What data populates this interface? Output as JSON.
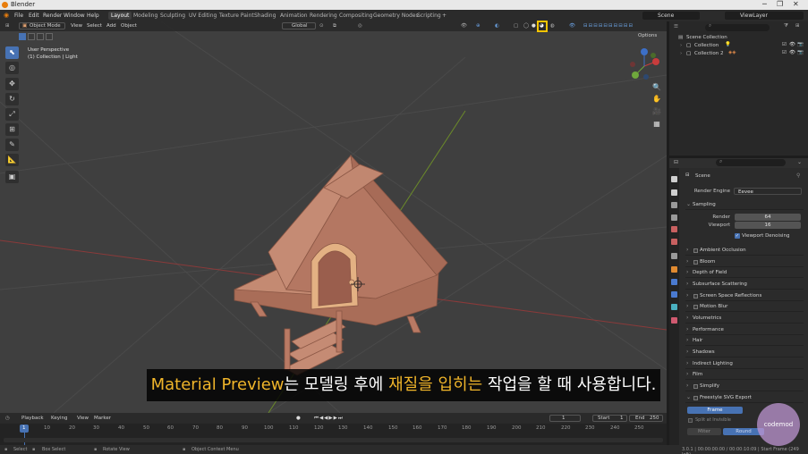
{
  "titlebar": {
    "title": "Blender"
  },
  "menu": [
    "File",
    "Edit",
    "Render",
    "Window",
    "Help"
  ],
  "workspaces": [
    "Layout",
    "Modeling",
    "Sculpting",
    "UV Editing",
    "Texture Paint",
    "Shading",
    "Animation",
    "Rendering",
    "Compositing",
    "Geometry Nodes",
    "Scripting",
    "+"
  ],
  "scene_selector": "Scene",
  "viewlayer_selector": "ViewLayer",
  "viewport": {
    "mode": "Object Mode",
    "menus": [
      "View",
      "Select",
      "Add",
      "Object"
    ],
    "orientation": "Global",
    "options_label": "Options",
    "info_line1": "User Perspective",
    "info_line2": "(1) Collection | Light"
  },
  "subtitle": {
    "part1": "Material Preview",
    "part2": "는 모델링 후에 ",
    "part3": "재질을 입히는",
    "part4": " 작업을 할 때 사용합니다."
  },
  "timeline": {
    "menus": [
      "Playback",
      "Keying",
      "View",
      "Marker"
    ],
    "current_frame": "1",
    "start_label": "Start",
    "start": "1",
    "end_label": "End",
    "end": "250",
    "ticks": [
      "1",
      "10",
      "20",
      "30",
      "40",
      "50",
      "60",
      "70",
      "80",
      "90",
      "100",
      "110",
      "120",
      "130",
      "140",
      "150",
      "160",
      "170",
      "180",
      "190",
      "200",
      "210",
      "220",
      "230",
      "240",
      "250"
    ]
  },
  "statusbar": {
    "select": "Select",
    "box_select": "Box Select",
    "rotate": "Rotate View",
    "context": "Object Context Menu",
    "version": "3.0.1 | 00:00:00:00 / 00:00:10:09 | Start Frame (249 left)"
  },
  "outliner": {
    "root": "Scene Collection",
    "items": [
      "Collection",
      "Collection 2"
    ]
  },
  "properties": {
    "breadcrumb": "Scene",
    "render_engine_label": "Render Engine",
    "render_engine": "Eevee",
    "sampling": "Sampling",
    "render_label": "Render",
    "render_value": "64",
    "viewport_label": "Viewport",
    "viewport_value": "16",
    "viewport_denoising": "Viewport Denoising",
    "sections": [
      "Ambient Occlusion",
      "Bloom",
      "Depth of Field",
      "Subsurface Scattering",
      "Screen Space Reflections",
      "Motion Blur",
      "Volumetrics",
      "Performance",
      "Hair",
      "Shadows",
      "Indirect Lighting",
      "Film",
      "Simplify",
      "Freestyle SVG Export"
    ],
    "sections_with_checkbox": [
      true,
      true,
      false,
      false,
      true,
      true,
      false,
      false,
      false,
      false,
      false,
      false,
      true,
      true
    ],
    "frame_label": "Frame",
    "split_label": "Split at Invisible",
    "miter_label": "Miter",
    "round_label": "Round"
  },
  "watermark": "codemod",
  "colors": {
    "accent": "#4772b3",
    "highlight": "#f0b52a",
    "house": "#b97a64"
  }
}
